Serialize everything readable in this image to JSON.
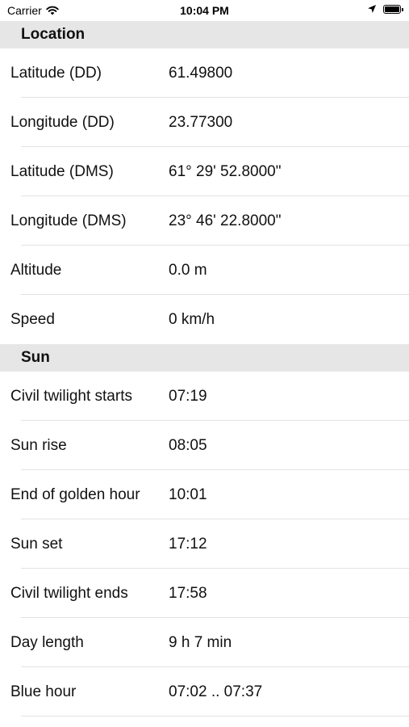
{
  "status": {
    "carrier": "Carrier",
    "time": "10:04 PM"
  },
  "sections": {
    "location": {
      "title": "Location",
      "rows": [
        {
          "label": "Latitude (DD)",
          "value": "61.49800"
        },
        {
          "label": "Longitude (DD)",
          "value": "23.77300"
        },
        {
          "label": "Latitude (DMS)",
          "value": "61° 29' 52.8000\""
        },
        {
          "label": "Longitude (DMS)",
          "value": "23° 46' 22.8000\""
        },
        {
          "label": "Altitude",
          "value": "0.0 m"
        },
        {
          "label": "Speed",
          "value": "0  km/h"
        }
      ]
    },
    "sun": {
      "title": "Sun",
      "rows": [
        {
          "label": "Civil twilight starts",
          "value": "07:19"
        },
        {
          "label": "Sun rise",
          "value": "08:05"
        },
        {
          "label": "End of golden hour",
          "value": "10:01"
        },
        {
          "label": "Sun set",
          "value": "17:12"
        },
        {
          "label": "Civil twilight ends",
          "value": "17:58"
        },
        {
          "label": "Day length",
          "value": "9 h 7 min"
        },
        {
          "label": "Blue hour",
          "value": "07:02 .. 07:37"
        }
      ]
    }
  }
}
